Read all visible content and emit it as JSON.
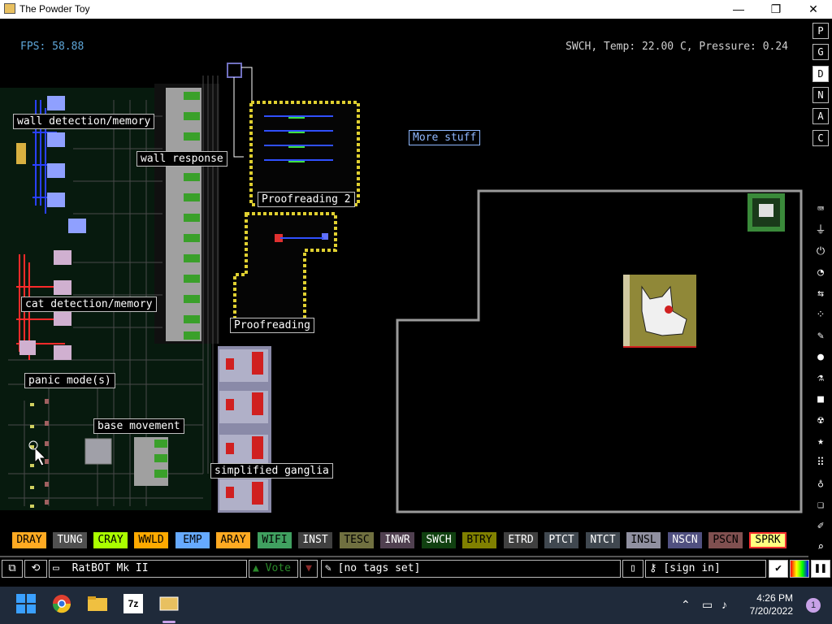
{
  "window": {
    "title": "The Powder Toy",
    "minimize": "—",
    "maximize": "❐",
    "close": "✕"
  },
  "hud": {
    "fps": "FPS: 58.88",
    "status": "SWCH, Temp: 22.00 C, Pressure: 0.24"
  },
  "labels": {
    "wall_detection": "wall detection/memory",
    "wall_response": "wall response",
    "proofreading2": "Proofreading 2",
    "more_stuff": "More stuff",
    "cat_detection": "cat detection/memory",
    "proofreading": "Proofreading",
    "panic_mode": "panic mode(s)",
    "base_movement": "base movement",
    "simplified_ganglia": "simplified ganglia"
  },
  "right_menu": {
    "buttons": [
      "P",
      "G",
      "D",
      "N",
      "A",
      "C"
    ],
    "icons": [
      "keyboard-icon",
      "plug-icon",
      "power-icon",
      "gauge-icon",
      "arrows-icon",
      "dots-icon",
      "brush-icon",
      "drop-icon",
      "flask-icon",
      "square-icon",
      "radiation-icon",
      "star-icon",
      "grid-icon",
      "bulb-icon",
      "bookmark-icon",
      "paint-icon",
      "search-icon"
    ],
    "icon_glyphs": [
      "⌨",
      "⏚",
      "⏻",
      "◔",
      "⇆",
      "⁘",
      "✎",
      "●",
      "⚗",
      "■",
      "☢",
      "★",
      "⠿",
      "♁",
      "❏",
      "✐",
      "⌕"
    ]
  },
  "elements": [
    {
      "name": "DRAY",
      "bg": "#ffaa22",
      "fg": "#000000"
    },
    {
      "name": "TUNG",
      "bg": "#505050",
      "fg": "#ffffff"
    },
    {
      "name": "CRAY",
      "bg": "#aaff00",
      "fg": "#000000"
    },
    {
      "name": "WWLD",
      "bg": "#ffaa00",
      "fg": "#000000"
    },
    {
      "name": "EMP",
      "bg": "#66aaff",
      "fg": "#000000"
    },
    {
      "name": "ARAY",
      "bg": "#ffaa22",
      "fg": "#000000"
    },
    {
      "name": "WIFI",
      "bg": "#40a060",
      "fg": "#000000"
    },
    {
      "name": "INST",
      "bg": "#404040",
      "fg": "#ffffff"
    },
    {
      "name": "TESC",
      "bg": "#707040",
      "fg": "#000000"
    },
    {
      "name": "INWR",
      "bg": "#504050",
      "fg": "#ffffff"
    },
    {
      "name": "SWCH",
      "bg": "#104010",
      "fg": "#ffffff"
    },
    {
      "name": "BTRY",
      "bg": "#808000",
      "fg": "#000000"
    },
    {
      "name": "ETRD",
      "bg": "#404040",
      "fg": "#ffffff"
    },
    {
      "name": "PTCT",
      "bg": "#404850",
      "fg": "#ffffff"
    },
    {
      "name": "NTCT",
      "bg": "#404850",
      "fg": "#ffffff"
    },
    {
      "name": "INSL",
      "bg": "#9090a0",
      "fg": "#000000"
    },
    {
      "name": "NSCN",
      "bg": "#505080",
      "fg": "#ffffff"
    },
    {
      "name": "PSCN",
      "bg": "#805050",
      "fg": "#000000"
    },
    {
      "name": "SPRK",
      "bg": "#ffff80",
      "fg": "#000000",
      "selected": true
    }
  ],
  "bottom": {
    "save_name": "RatBOT Mk II",
    "vote": "Vote",
    "tags": "[no tags set]",
    "sign_in": "[sign in]"
  },
  "taskbar": {
    "apps": [
      "windows-start-icon",
      "chrome-icon",
      "file-explorer-icon",
      "7zip-icon",
      "powder-toy-icon"
    ],
    "label_7z": "7z",
    "time": "4:26 PM",
    "date": "7/20/2022",
    "notifications": "1"
  }
}
